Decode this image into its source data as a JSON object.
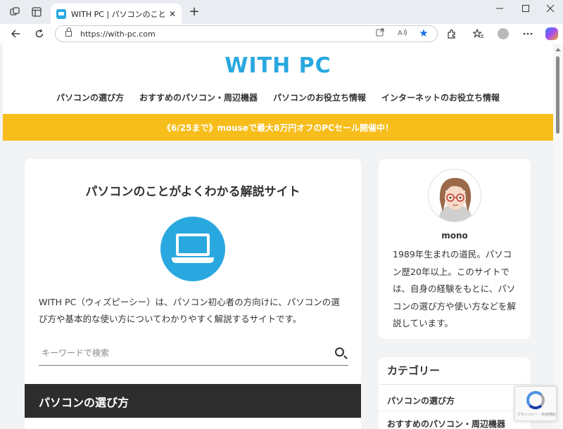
{
  "browser": {
    "tab_title": "WITH PC | パソコンのことがよくわかる解説サイト",
    "tab_close": "✕",
    "new_tab": "+",
    "url": "https://with-pc.com"
  },
  "site": {
    "logo": "WITH PC",
    "nav": [
      "パソコンの選び方",
      "おすすめのパソコン・周辺機器",
      "パソコンのお役立ち情報",
      "インターネットのお役立ち情報"
    ],
    "banner": "《6/25まで》mouseで最大8万円オフのPCセール開催中！",
    "brand_color": "#29a8e0",
    "banner_color": "#f7bd1b"
  },
  "main": {
    "title": "パソコンのことがよくわかる解説サイト",
    "intro": "WITH PC（ウィズピーシー）は、パソコン初心者の方向けに、パソコンの選び方や基本的な使い方についてわかりやすく解説するサイトです。",
    "search_placeholder": "キーワードで検索",
    "section_title": "パソコンの選び方"
  },
  "profile": {
    "name": "mono",
    "text": "1989年生まれの道民。パソコン歴20年以上。このサイトでは、自身の経験をもとに、パソコンの選び方や使い方などを解説しています。"
  },
  "categories": {
    "title": "カテゴリー",
    "items": [
      "パソコンの選び方",
      "おすすめのパソコン・周辺機器"
    ]
  },
  "recaptcha": {
    "text": "プライバシー・利用規約"
  }
}
